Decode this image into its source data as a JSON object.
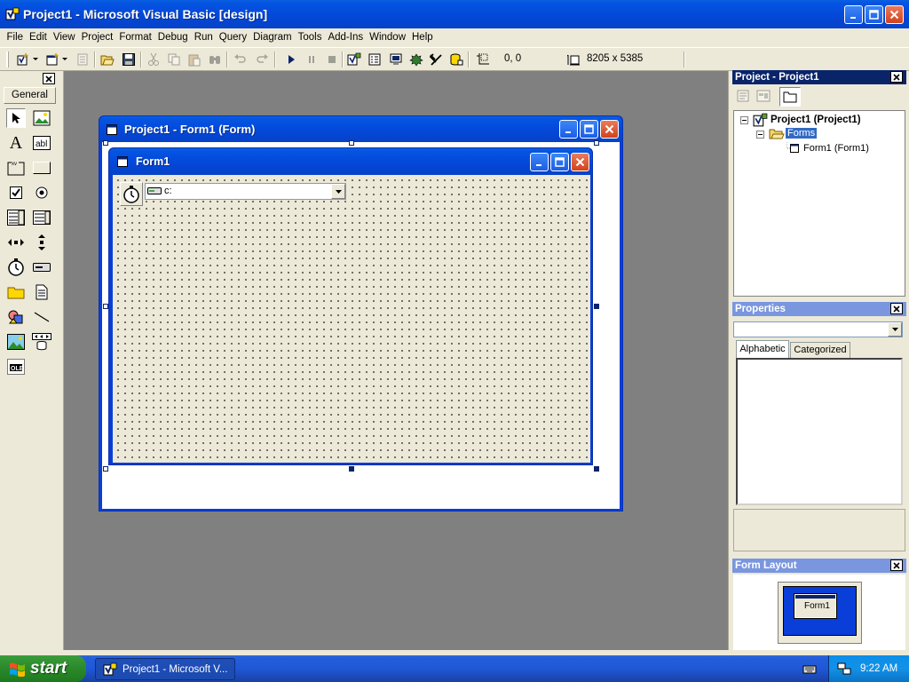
{
  "app": {
    "title": "Project1 - Microsoft Visual Basic [design]"
  },
  "menu": [
    "File",
    "Edit",
    "View",
    "Project",
    "Format",
    "Debug",
    "Run",
    "Query",
    "Diagram",
    "Tools",
    "Add-Ins",
    "Window",
    "Help"
  ],
  "toolbar": {
    "position": "0, 0",
    "size": "8205 x 5385"
  },
  "toolbox": {
    "tab_label": "General",
    "tools": [
      "pointer",
      "picturebox",
      "label",
      "textbox",
      "frame",
      "commandbutton",
      "checkbox",
      "optionbutton",
      "combobox",
      "listbox",
      "hscrollbar",
      "vscrollbar",
      "timer",
      "drivelistbox",
      "dirlistbox",
      "filelistbox",
      "shape",
      "line",
      "image",
      "data",
      "ole"
    ]
  },
  "designer": {
    "window_title": "Project1 - Form1 (Form)",
    "form_caption": "Form1",
    "drive_value": "c:"
  },
  "project_explorer": {
    "title": "Project - Project1",
    "root": "Project1 (Project1)",
    "folder": "Forms",
    "item": "Form1 (Form1)"
  },
  "properties": {
    "title": "Properties",
    "object_value": "",
    "tabs": [
      "Alphabetic",
      "Categorized"
    ]
  },
  "form_layout": {
    "title": "Form Layout",
    "form_label": "Form1"
  },
  "taskbar": {
    "start_label": "start",
    "task_label": "Project1 - Microsoft V...",
    "clock": "9:22 AM"
  },
  "colors": {
    "titlebar": "#0454e3",
    "active_panel": "#0a246a",
    "inactive_panel": "#7a96df",
    "workspace": "#808080",
    "form_back": "#ece9d8",
    "start": "#2d8c2d"
  }
}
